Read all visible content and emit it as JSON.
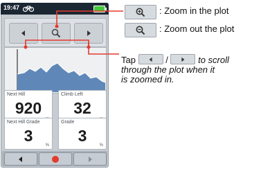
{
  "device": {
    "status": {
      "time": "19:47"
    },
    "fields": [
      {
        "label": "Next Hill",
        "value": "920",
        "unit": "m"
      },
      {
        "label": "Climb Left",
        "value": "32",
        "unit": "m"
      },
      {
        "label": "Next Hill Grade",
        "value": "3",
        "unit": "%"
      },
      {
        "label": "Grade",
        "value": "3",
        "unit": "%"
      }
    ],
    "colors": {
      "accent_red": "#e43a2e",
      "plot_fill": "#5f88b8",
      "battery": "#45c93c"
    }
  },
  "legend": {
    "zoom_in_text": ": Zoom in the plot",
    "zoom_out_text": ": Zoom out the plot",
    "tap_word": "Tap",
    "slash": "/",
    "to_scroll": "to scroll",
    "line2": "through the plot when it",
    "line3": "is zoomed in."
  },
  "icons": [
    "zoom-in-icon",
    "zoom-out-icon",
    "left-arrow-icon",
    "right-arrow-icon",
    "record-icon",
    "bike-icon",
    "battery-icon"
  ]
}
